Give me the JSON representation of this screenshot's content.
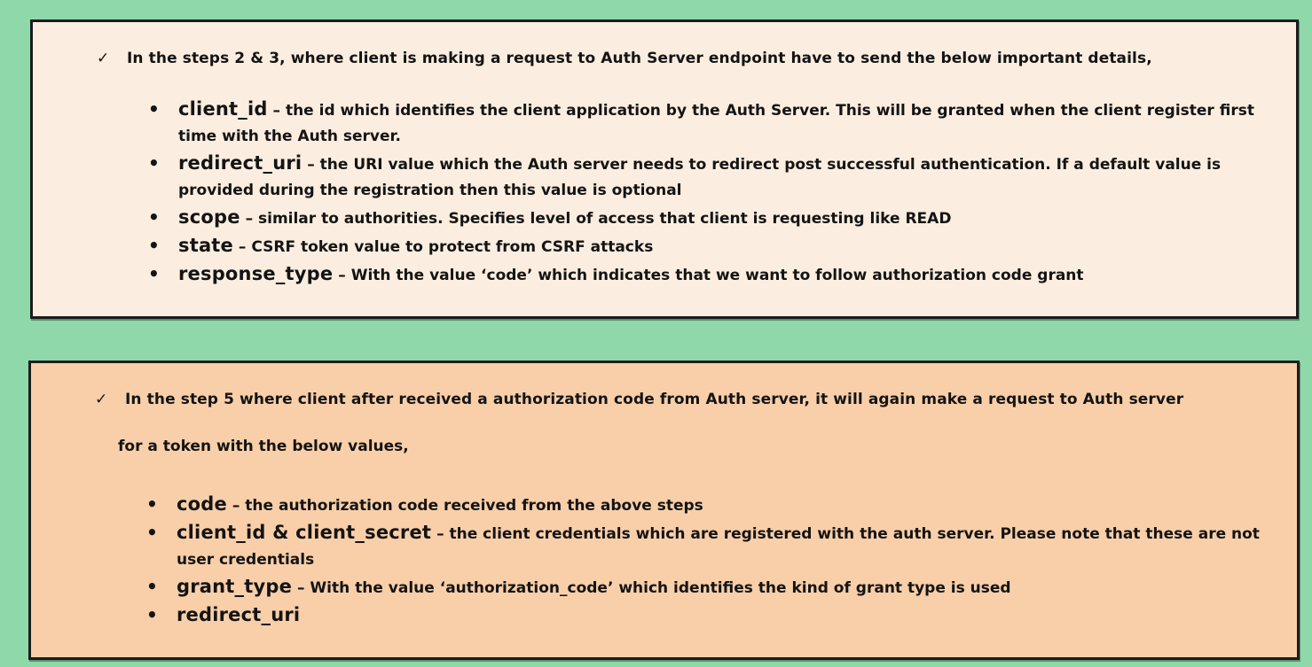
{
  "section1": {
    "check_icon": "check-mark-icon",
    "intro": "In the steps 2 & 3, where client is making a request to Auth Server endpoint have to send the below important details,",
    "items": [
      {
        "term": "client_id",
        "desc": " – the id which identifies the client application by the Auth Server. This will be granted when the client register first time with the Auth server."
      },
      {
        "term": "redirect_uri",
        "desc": " – the URI value which the Auth server needs to redirect post successful authentication. If a default value is provided during the registration then this value is optional"
      },
      {
        "term": "scope",
        "desc": " – similar to authorities. Specifies level of access that client is requesting like READ"
      },
      {
        "term": "state",
        "desc": " – CSRF token value to protect from CSRF attacks"
      },
      {
        "term": "response_type",
        "desc": " – With the value ‘code’ which indicates that we want to follow authorization code grant"
      }
    ]
  },
  "section2": {
    "check_icon": "check-mark-icon",
    "intro": "In the step 5 where client after received a authorization code from Auth server, it will again make a request to Auth server",
    "intro_cont": "for a token with the below values,",
    "items": [
      {
        "term": "code",
        "desc": " – the authorization code received from the above steps"
      },
      {
        "term": "client_id & client_secret",
        "desc": " – the client credentials which are registered with the auth server. Please note that these are not user credentials"
      },
      {
        "term": "grant_type",
        "desc": " – With the value ‘authorization_code’ which identifies the kind of grant type is used"
      },
      {
        "term": "redirect_uri",
        "desc": ""
      }
    ]
  },
  "colors": {
    "background": "#8ed8aa",
    "card1": "#fbeee0",
    "card2": "#f9cfa9",
    "border": "#1c1c1c"
  }
}
